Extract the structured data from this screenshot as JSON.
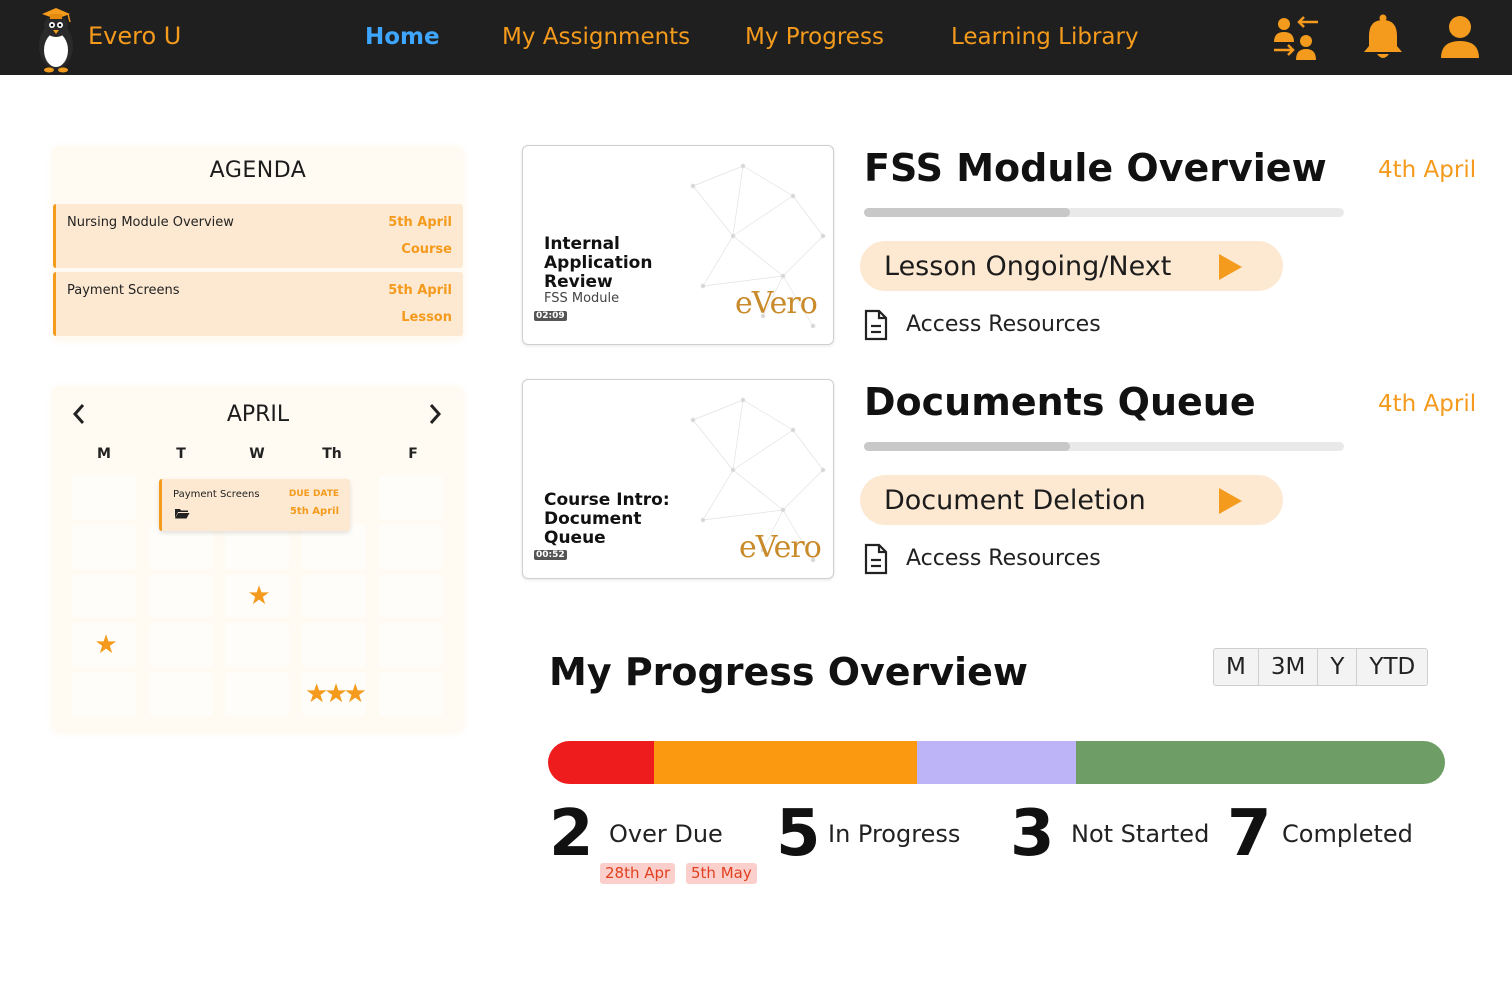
{
  "app": {
    "brand": "Evero U"
  },
  "nav": {
    "items": [
      {
        "label": "Home",
        "active": true
      },
      {
        "label": "My Assignments",
        "active": false
      },
      {
        "label": "My Progress",
        "active": false
      },
      {
        "label": "Learning Library",
        "active": false
      }
    ],
    "icons": [
      "switch-users-icon",
      "bell-icon",
      "user-icon"
    ]
  },
  "agenda": {
    "title": "AGENDA",
    "items": [
      {
        "name": "Nursing Module Overview",
        "date": "5th April",
        "type": "Course"
      },
      {
        "name": "Payment Screens",
        "date": "5th April",
        "type": "Lesson"
      }
    ]
  },
  "calendar": {
    "month": "APRIL",
    "days": [
      "M",
      "T",
      "W",
      "Th",
      "F"
    ],
    "event": {
      "name": "Payment Screens",
      "due_label": "DUE DATE",
      "date": "5th April"
    },
    "stars": {
      "r2c2": "★",
      "r3c0": "★",
      "r4c3": "★★★"
    }
  },
  "modules": [
    {
      "title": "FSS Module Overview",
      "date": "4th April",
      "progress": 0.43,
      "thumb": {
        "title": "Internal\nApplication\nReview",
        "subtitle": "FSS Module",
        "duration": "02:09",
        "logo": "eVero"
      },
      "action": "Lesson Ongoing/Next",
      "resources": "Access Resources"
    },
    {
      "title": "Documents Queue",
      "date": "4th April",
      "progress": 0.43,
      "thumb": {
        "title": "Course Intro:\nDocument\nQueue",
        "subtitle": "",
        "duration": "00:52",
        "logo": "eVero"
      },
      "action": "Document Deletion",
      "resources": "Access Resources"
    }
  ],
  "progress_overview": {
    "title": "My Progress Overview",
    "ranges": [
      "M",
      "3M",
      "Y",
      "YTD"
    ],
    "segments": [
      {
        "name": "Over Due",
        "count": "2",
        "color": "#ee1c1c"
      },
      {
        "name": "In Progress",
        "count": "5",
        "color": "#fb9a10"
      },
      {
        "name": "Not Started",
        "count": "3",
        "color": "#bdb3f7"
      },
      {
        "name": "Completed",
        "count": "7",
        "color": "#6e9e66"
      }
    ],
    "overdue_dates": [
      "28th Apr",
      "5th May"
    ]
  }
}
